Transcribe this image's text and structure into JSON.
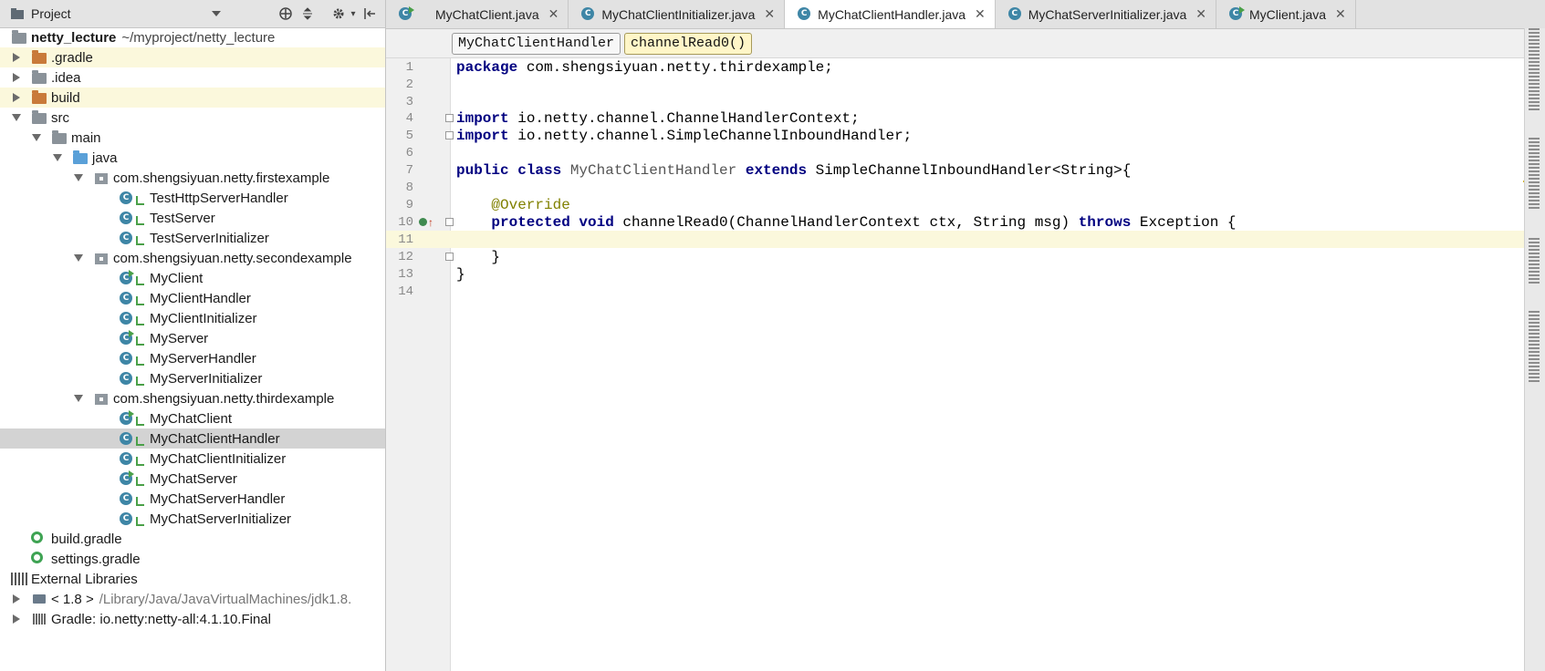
{
  "project_panel": {
    "title": "Project",
    "tree": [
      {
        "label": "netty_lecture",
        "path": "~/myproject/netty_lecture",
        "icon": "module-folder-icon",
        "bold": true,
        "expanded": true
      },
      {
        "label": ".gradle",
        "icon": "folder-icon",
        "expanded": false
      },
      {
        "label": ".idea",
        "icon": "folder-icon",
        "expanded": false
      },
      {
        "label": "build",
        "icon": "folder-icon",
        "expanded": false
      },
      {
        "label": "src",
        "icon": "folder-icon",
        "expanded": true
      },
      {
        "label": "main",
        "icon": "folder-icon",
        "expanded": true
      },
      {
        "label": "java",
        "icon": "source-folder-icon",
        "expanded": true
      },
      {
        "label": "com.shengsiyuan.netty.firstexample",
        "icon": "package-icon",
        "expanded": true
      },
      {
        "label": "TestHttpServerHandler",
        "icon": "class-icon"
      },
      {
        "label": "TestServer",
        "icon": "class-icon"
      },
      {
        "label": "TestServerInitializer",
        "icon": "class-icon"
      },
      {
        "label": "com.shengsiyuan.netty.secondexample",
        "icon": "package-icon",
        "expanded": true
      },
      {
        "label": "MyClient",
        "icon": "runnable-class-icon"
      },
      {
        "label": "MyClientHandler",
        "icon": "class-icon"
      },
      {
        "label": "MyClientInitializer",
        "icon": "class-icon"
      },
      {
        "label": "MyServer",
        "icon": "runnable-class-icon"
      },
      {
        "label": "MyServerHandler",
        "icon": "class-icon"
      },
      {
        "label": "MyServerInitializer",
        "icon": "class-icon"
      },
      {
        "label": "com.shengsiyuan.netty.thirdexample",
        "icon": "package-icon",
        "expanded": true
      },
      {
        "label": "MyChatClient",
        "icon": "runnable-class-icon"
      },
      {
        "label": "MyChatClientHandler",
        "icon": "class-icon",
        "selected": true
      },
      {
        "label": "MyChatClientInitializer",
        "icon": "class-icon"
      },
      {
        "label": "MyChatServer",
        "icon": "runnable-class-icon"
      },
      {
        "label": "MyChatServerHandler",
        "icon": "class-icon"
      },
      {
        "label": "MyChatServerInitializer",
        "icon": "class-icon"
      },
      {
        "label": "build.gradle",
        "icon": "gradle-icon"
      },
      {
        "label": "settings.gradle",
        "icon": "gradle-icon"
      },
      {
        "label": "External Libraries",
        "icon": "libraries-icon"
      },
      {
        "label": "< 1.8 >",
        "path": "/Library/Java/JavaVirtualMachines/jdk1.8.",
        "icon": "jdk-icon",
        "expanded": false
      },
      {
        "label": "Gradle: io.netty:netty-all:4.1.10.Final",
        "icon": "gradle-library-icon",
        "expanded": false
      }
    ]
  },
  "tabs": [
    {
      "label": "MyChatClient.java",
      "icon": "runnable-class-icon",
      "active": false
    },
    {
      "label": "MyChatClientInitializer.java",
      "icon": "class-icon",
      "active": false
    },
    {
      "label": "MyChatClientHandler.java",
      "icon": "class-icon",
      "active": true
    },
    {
      "label": "MyChatServerInitializer.java",
      "icon": "class-icon",
      "active": false
    },
    {
      "label": "MyClient.java",
      "icon": "runnable-class-icon",
      "active": false
    }
  ],
  "breadcrumb": {
    "class_name": "MyChatClientHandler",
    "method": "channelRead0()"
  },
  "editor": {
    "current_line": 11,
    "lines": [
      {
        "n": "1",
        "tokens": [
          [
            "kw",
            "package"
          ],
          [
            "",
            "com.shengsiyuan.netty.thirdexample;"
          ]
        ]
      },
      {
        "n": "2",
        "tokens": []
      },
      {
        "n": "3",
        "tokens": []
      },
      {
        "n": "4",
        "tokens": [
          [
            "kw",
            "import"
          ],
          [
            "",
            "io.netty.channel.ChannelHandlerContext;"
          ]
        ]
      },
      {
        "n": "5",
        "tokens": [
          [
            "kw",
            "import"
          ],
          [
            "",
            "io.netty.channel.SimpleChannelInboundHandler;"
          ]
        ]
      },
      {
        "n": "6",
        "tokens": []
      },
      {
        "n": "7",
        "tokens": [
          [
            "kw",
            "public class"
          ],
          [
            "cls",
            "MyChatClientHandler"
          ],
          [
            "kw",
            "extends"
          ],
          [
            "",
            "SimpleChannelInboundHandler<String>{"
          ]
        ]
      },
      {
        "n": "8",
        "tokens": []
      },
      {
        "n": "9",
        "tokens": [
          [
            "ann",
            "@Override"
          ]
        ]
      },
      {
        "n": "10",
        "tokens": [
          [
            "kw",
            "protected void"
          ],
          [
            "",
            "channelRead0(ChannelHandlerContext ctx, String msg)"
          ],
          [
            "kw",
            "throws"
          ],
          [
            "",
            "Exception {"
          ]
        ]
      },
      {
        "n": "11",
        "tokens": []
      },
      {
        "n": "12",
        "tokens": [
          [
            "",
            "}"
          ]
        ]
      },
      {
        "n": "13",
        "tokens": [
          [
            "",
            "}"
          ]
        ]
      },
      {
        "n": "14",
        "tokens": []
      }
    ]
  },
  "colors": {
    "keyword": "#000080",
    "class_name": "#555555",
    "annotation": "#808000",
    "current_line_bg": "#fbf8dc",
    "selection_bg": "#d3d3d3"
  }
}
